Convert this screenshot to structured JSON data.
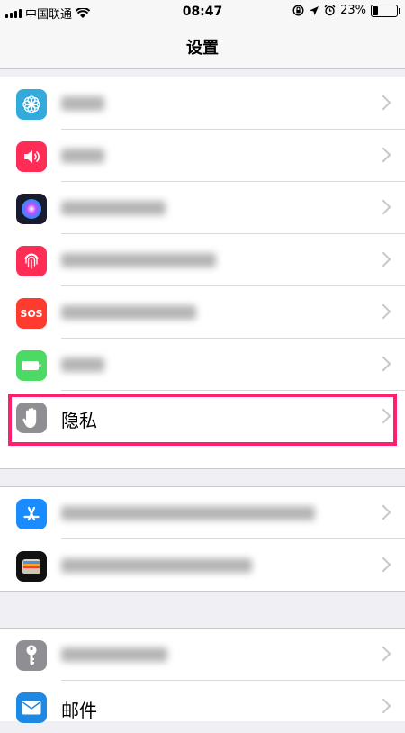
{
  "status_bar": {
    "carrier": "中国联通",
    "time": "08:47",
    "battery_text": "23%",
    "battery_level": 0.23,
    "icons": [
      "signal-icon",
      "wifi-icon",
      "rotation-lock-icon",
      "location-icon",
      "alarm-icon",
      "battery-icon"
    ]
  },
  "nav": {
    "title": "设置"
  },
  "colors": {
    "highlight": "#ff1f6e",
    "general": "#34aadc",
    "sounds": "#ff2d55",
    "siri": "#1a1a2e",
    "touchid": "#ff2d55",
    "sos": "#ff3b30",
    "battery": "#4cd964",
    "privacy": "#8e8e93",
    "appstore": "#1a8cff",
    "wallet": "#111111",
    "passwords": "#8e8e93",
    "mail": "#1e88e5"
  },
  "rows": {
    "privacy_label": "隐私",
    "mail_label": "邮件"
  }
}
